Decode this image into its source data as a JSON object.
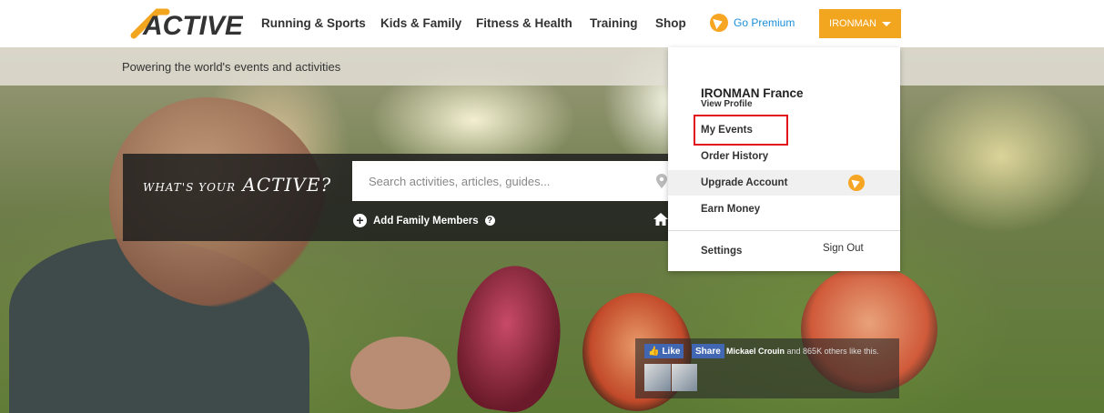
{
  "brand": {
    "logo_text": "ACTIVE",
    "accent": "#f2a51e",
    "link_color": "#1a8fd8"
  },
  "nav": {
    "items": [
      "Running & Sports",
      "Kids & Family",
      "Fitness & Health",
      "Training",
      "Shop"
    ],
    "premium_label": "Go Premium",
    "user_label": "IRONMAN"
  },
  "hero": {
    "tagline": "Powering the world's events and activities",
    "script_small": "WHAT'S YOUR",
    "script_big": "ACTIVE?",
    "search_placeholder": "Search activities, articles, guides...",
    "add_family_label": "Add Family Members"
  },
  "dropdown": {
    "profile_name": "IRONMAN France",
    "view_profile": "View Profile",
    "items": [
      "My Events",
      "Order History",
      "Upgrade Account",
      "Earn Money"
    ],
    "settings": "Settings",
    "sign_out": "Sign Out"
  },
  "facebook": {
    "like": "Like",
    "share": "Share",
    "friend": "Mickael Crouin",
    "others": "and 865K others like this."
  }
}
